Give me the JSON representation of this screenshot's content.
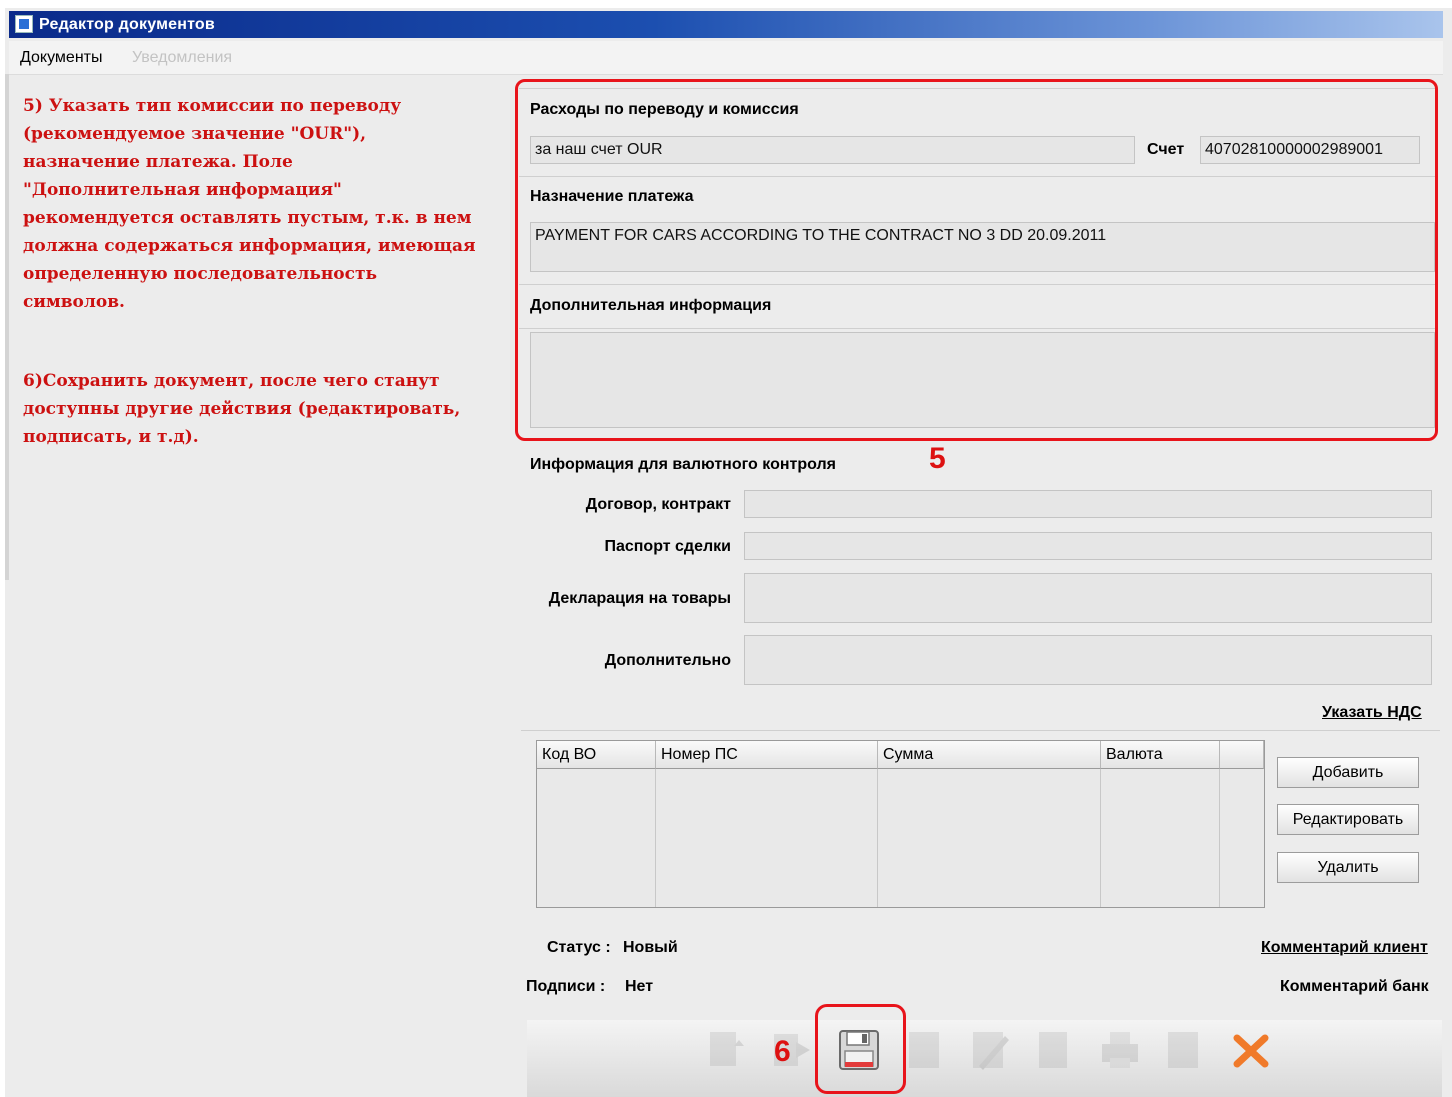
{
  "window": {
    "title": "Редактор документов"
  },
  "menu": {
    "items": [
      {
        "label": "Документы",
        "enabled": true
      },
      {
        "label": "Уведомления",
        "enabled": false
      }
    ]
  },
  "annotations": {
    "step5_lines": [
      "5) Указать тип комиссии по переводу",
      "(рекомендуемое значение \"OUR\"),",
      "назначение платежа. Поле",
      "\"Дополнительная информация\"",
      "рекомендуется оставлять пустым, т.к. в нем",
      "должна содержаться информация, имеющая",
      "определенную последовательность",
      "символов."
    ],
    "step6_lines": [
      "6)Сохранить документ, после чего станут",
      "доступны другие действия (редактировать,",
      "подписать, и т.д)."
    ],
    "marker5": "5",
    "marker6": "6"
  },
  "form": {
    "charges": {
      "label": "Расходы по переводу и комиссия",
      "value": "за наш счет OUR",
      "account_label": "Счет",
      "account_value": "40702810000002989001"
    },
    "purpose": {
      "label": "Назначение платежа",
      "value": "PAYMENT FOR CARS ACCORDING TO THE CONTRACT NO 3 DD 20.09.2011"
    },
    "additional_info": {
      "label": "Дополнительная информация",
      "value": ""
    },
    "currency_control": {
      "title": "Информация для валютного контроля",
      "contract_label": "Договор, контракт",
      "contract_value": "",
      "passport_label": "Паспорт сделки",
      "passport_value": "",
      "declaration_label": "Декларация на товары",
      "declaration_value": "",
      "extra_label": "Дополнительно",
      "extra_value": ""
    },
    "vat_link": "Указать НДС",
    "table": {
      "columns": [
        "Код ВО",
        "Номер ПС",
        "Сумма",
        "Валюта"
      ],
      "rows": []
    },
    "buttons": {
      "add": "Добавить",
      "edit": "Редактировать",
      "delete": "Удалить"
    },
    "status": {
      "label": "Статус :",
      "value": "Новый"
    },
    "signatures": {
      "label": "Подписи :",
      "value": "Нет"
    },
    "client_comment_link": "Комментарий клиент",
    "bank_comment": "Комментарий банк"
  },
  "toolbar": {
    "icons": [
      "new-document-icon",
      "forward-icon",
      "save-icon",
      "template-icon",
      "edit-icon",
      "copy-icon",
      "print-icon",
      "delete-document-icon",
      "close-icon"
    ]
  },
  "colors": {
    "annotation_red": "#cc1111",
    "highlight_border": "#e8141b",
    "titlebar": "#1c4fb0"
  }
}
